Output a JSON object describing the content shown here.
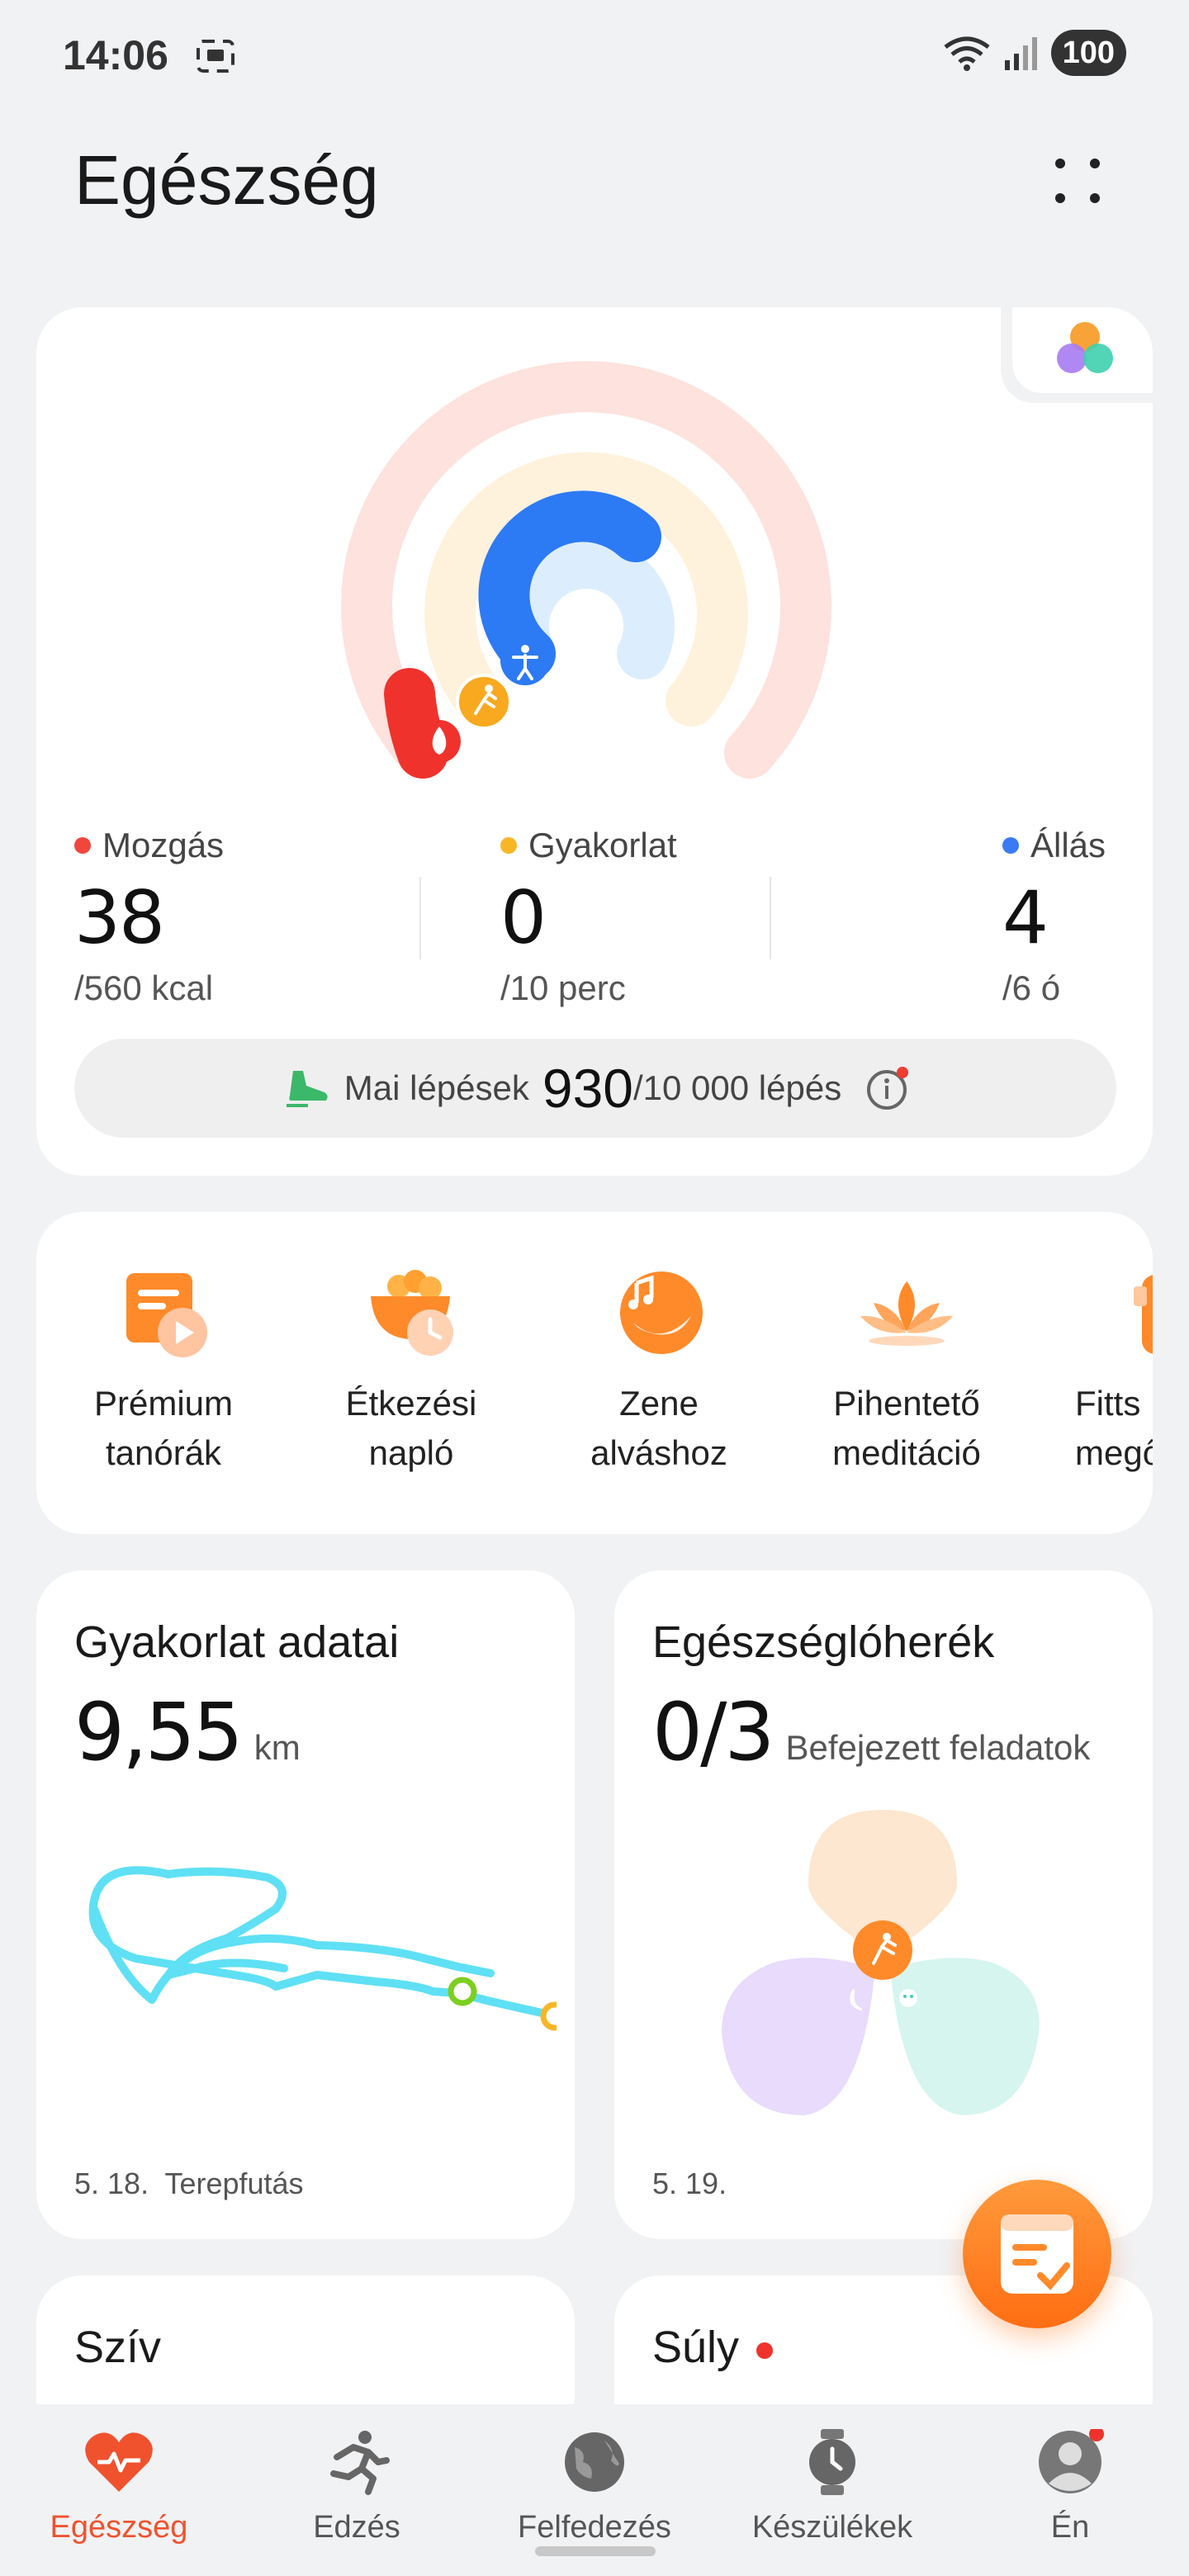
{
  "status": {
    "time": "14:06",
    "battery": "100"
  },
  "header": {
    "title": "Egészség"
  },
  "activity": {
    "move": {
      "label": "Mozgás",
      "value": "38",
      "goal": "/560 kcal",
      "color": "#f0463c",
      "progress": 0.068
    },
    "exercise": {
      "label": "Gyakorlat",
      "value": "0",
      "goal": "/10 perc",
      "color": "#f8b627",
      "progress": 0
    },
    "stand": {
      "label": "Állás",
      "value": "4",
      "goal": "/6 ó",
      "color": "#3a7bf5",
      "progress": 0.667
    },
    "steps": {
      "label": "Mai lépések",
      "value": "930",
      "goal": "/10 000 lépés"
    }
  },
  "shortcuts": [
    {
      "line1": "Prémium",
      "line2": "tanórák",
      "icon": "premium-lessons-icon"
    },
    {
      "line1": "Étkezési",
      "line2": "napló",
      "icon": "meal-log-icon"
    },
    {
      "line1": "Zene",
      "line2": "alváshoz",
      "icon": "sleep-music-icon"
    },
    {
      "line1": "Pihentető",
      "line2": "meditáció",
      "icon": "meditation-icon"
    },
    {
      "line1": "Fitts",
      "line2": "megőr",
      "icon": "fitness-icon"
    }
  ],
  "exercise_card": {
    "title": "Gyakorlat adatai",
    "value": "9,55",
    "unit": "km",
    "date": "5. 18.",
    "type": "Terepfutás"
  },
  "clover_card": {
    "title": "Egészséglóherék",
    "value": "0/3",
    "unit": "Befejezett feladatok",
    "date": "5. 19."
  },
  "heart_card": {
    "title": "Szív"
  },
  "weight_card": {
    "title": "Súly"
  },
  "nav": [
    {
      "label": "Egészség",
      "icon": "heart-icon",
      "active": true
    },
    {
      "label": "Edzés",
      "icon": "running-icon"
    },
    {
      "label": "Felfedezés",
      "icon": "globe-icon"
    },
    {
      "label": "Készülékek",
      "icon": "watch-icon"
    },
    {
      "label": "Én",
      "icon": "profile-icon"
    }
  ]
}
